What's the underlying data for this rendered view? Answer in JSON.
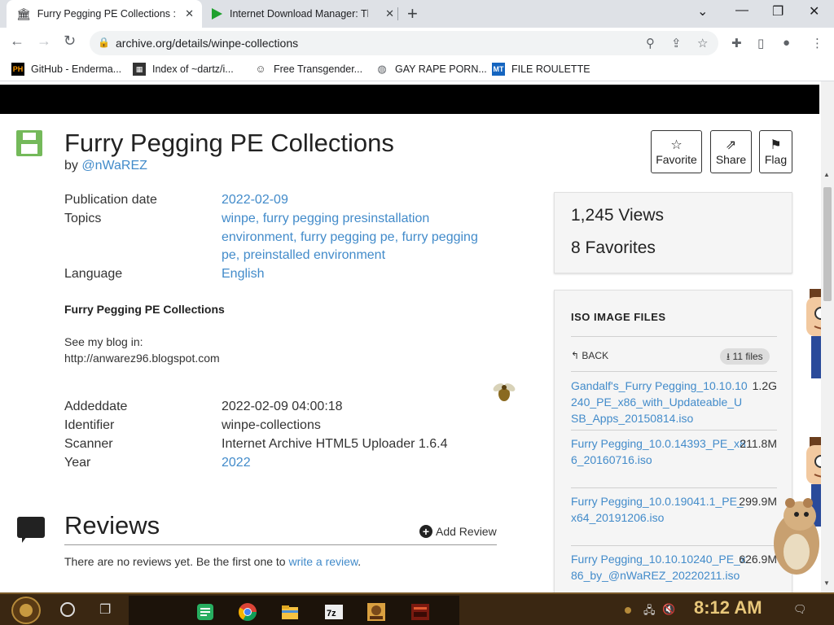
{
  "browser": {
    "tabs": [
      {
        "title": "Furry Pegging PE Collections : (",
        "close": "✕",
        "active": true
      },
      {
        "title": "Internet Download Manager: Th",
        "close": "✕",
        "active": false
      }
    ],
    "new_tab": "+",
    "window_controls": {
      "dropdown": "⌄",
      "minimize": "—",
      "restore": "❐",
      "close": "✕"
    },
    "url": "archive.org/details/winpe-collections",
    "bookmarks": [
      {
        "label": "GitHub - Enderma...",
        "icon": "PH"
      },
      {
        "label": "Index of ~dartz/i...",
        "icon": "grid"
      },
      {
        "label": "Free Transgender...",
        "icon": "mask"
      },
      {
        "label": "GAY RAPE PORN...",
        "icon": "globe"
      },
      {
        "label": "FILE ROULETTE",
        "icon": "MT"
      }
    ]
  },
  "item": {
    "title": "Furry Pegging PE Collections",
    "by_label": "by",
    "author": "@nWaREZ",
    "actions": {
      "favorite": "Favorite",
      "share": "Share",
      "flag": "Flag"
    },
    "meta": {
      "publication_date_label": "Publication date",
      "publication_date": "2022-02-09",
      "topics_label": "Topics",
      "topics_line1": "winpe, furry pegging presinstallation",
      "topics_line2": "environment, furry pegging pe, furry pegging",
      "topics_line3": "pe, preinstalled environment",
      "language_label": "Language",
      "language": "English"
    },
    "description": {
      "title": "Furry Pegging PE Collections",
      "blog_label": "See my blog in:",
      "blog_url": "http://anwarez96.blogspot.com"
    },
    "details": {
      "addeddate_label": "Addeddate",
      "addeddate": "2022-02-09 04:00:18",
      "identifier_label": "Identifier",
      "identifier": "winpe-collections",
      "scanner_label": "Scanner",
      "scanner": "Internet Archive HTML5 Uploader 1.6.4",
      "year_label": "Year",
      "year": "2022"
    },
    "reviews": {
      "title": "Reviews",
      "add_label": "Add Review",
      "empty_text": "There are no reviews yet. Be the first one to",
      "write_link": "write a review",
      "end": "."
    }
  },
  "sidebar": {
    "views": "1,245 Views",
    "favorites": "8 Favorites",
    "files_heading": "ISO IMAGE FILES",
    "back": "BACK",
    "files_count": "11 files",
    "files": [
      {
        "name": "Gandalf's_Furry Pegging_10.10.10240_PE_x86_with_Updateable_USB_Apps_20150814.iso",
        "size": "1.2G"
      },
      {
        "name": "Furry Pegging_10.0.14393_PE_x86_20160716.iso",
        "size": "211.8M"
      },
      {
        "name": "Furry Pegging_10.0.19041.1_PE_x64_20191206.iso",
        "size": "299.9M"
      },
      {
        "name": "Furry Pegging_10.10.10240_PE_x86_by_@nWaREZ_20220211.iso",
        "size": "626.9M"
      }
    ]
  },
  "taskbar": {
    "clock": "8:12 AM",
    "pinned": [
      "sublime-text",
      "chrome",
      "file-explorer",
      "7zip",
      "game",
      "media-app"
    ]
  },
  "colors": {
    "link": "#428bca",
    "tabstrip": "#dee1e6",
    "taskbar": "#3a2712",
    "clock": "#e8c77a",
    "floppy": "#74b95a"
  }
}
